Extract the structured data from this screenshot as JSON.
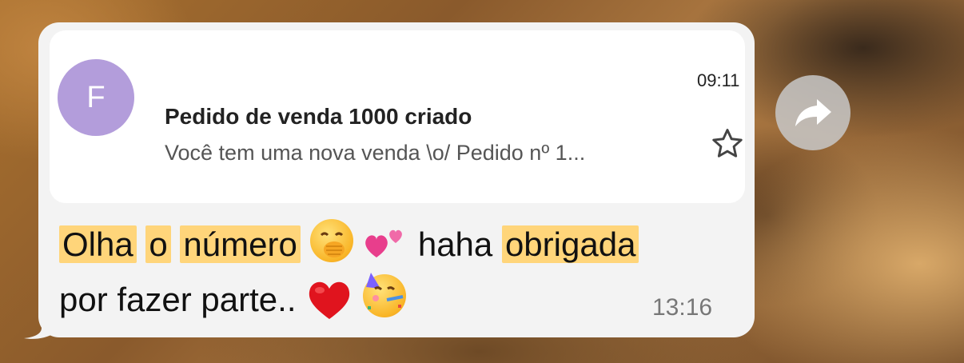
{
  "card": {
    "avatar_letter": "F",
    "sender": "",
    "time": "09:11",
    "title": "Pedido de venda 1000 criado",
    "preview": "Você tem uma nova venda \\o/ Pedido nº 1..."
  },
  "message": {
    "line1_words": [
      "Olha",
      "o",
      "número"
    ],
    "line1_plain": "haha",
    "line1_highlight_end": "obrigada",
    "line2": "por fazer parte..",
    "emojis": [
      "face-with-hand-over-mouth",
      "two-hearts",
      "red-heart",
      "partying-face"
    ],
    "time": "13:16"
  },
  "colors": {
    "bubble": "#f3f3f3",
    "card": "#ffffff",
    "avatar": "#b39ddb",
    "highlight": "#ffd57a"
  },
  "icons": {
    "star": "star-outline-icon",
    "share": "share-forward-icon"
  }
}
